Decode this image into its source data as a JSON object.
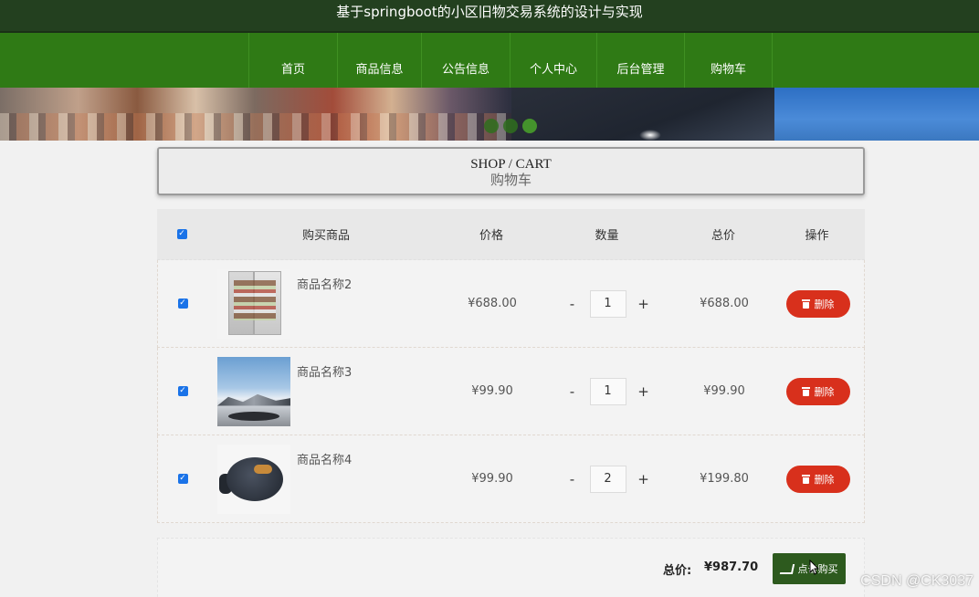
{
  "site": {
    "title": "基于springboot的小区旧物交易系统的设计与实现"
  },
  "nav": {
    "items": [
      {
        "label": "首页"
      },
      {
        "label": "商品信息"
      },
      {
        "label": "公告信息"
      },
      {
        "label": "个人中心"
      },
      {
        "label": "后台管理"
      },
      {
        "label": "购物车"
      }
    ]
  },
  "banner": {
    "slide_count": 3,
    "active_slide": 3
  },
  "page_header": {
    "en": "SHOP / CART",
    "cn": "购物车"
  },
  "cart": {
    "headers": {
      "product": "购买商品",
      "price": "价格",
      "qty": "数量",
      "total": "总价",
      "action": "操作"
    },
    "select_all_checked": true,
    "items": [
      {
        "checked": true,
        "name": "商品名称2",
        "image": "refrigerator",
        "price": "¥688.00",
        "qty": "1",
        "total": "¥688.00",
        "delete_label": "删除"
      },
      {
        "checked": true,
        "name": "商品名称3",
        "image": "landscape",
        "price": "¥99.90",
        "qty": "1",
        "total": "¥99.90",
        "delete_label": "删除"
      },
      {
        "checked": true,
        "name": "商品名称4",
        "image": "electric-grill",
        "price": "¥99.90",
        "qty": "2",
        "total": "¥199.80",
        "delete_label": "删除"
      }
    ],
    "minus": "-",
    "plus": "+",
    "check_mark": "✓",
    "summary": {
      "label": "总价:",
      "value": "¥987.70",
      "buy_label": "点击购买"
    }
  },
  "colors": {
    "nav": "#2f7a15",
    "topbar": "#23401f",
    "delete": "#d8301c",
    "buy": "#2d5a1e",
    "checkbox": "#1a73e8"
  },
  "watermark": "CSDN @CK3037"
}
